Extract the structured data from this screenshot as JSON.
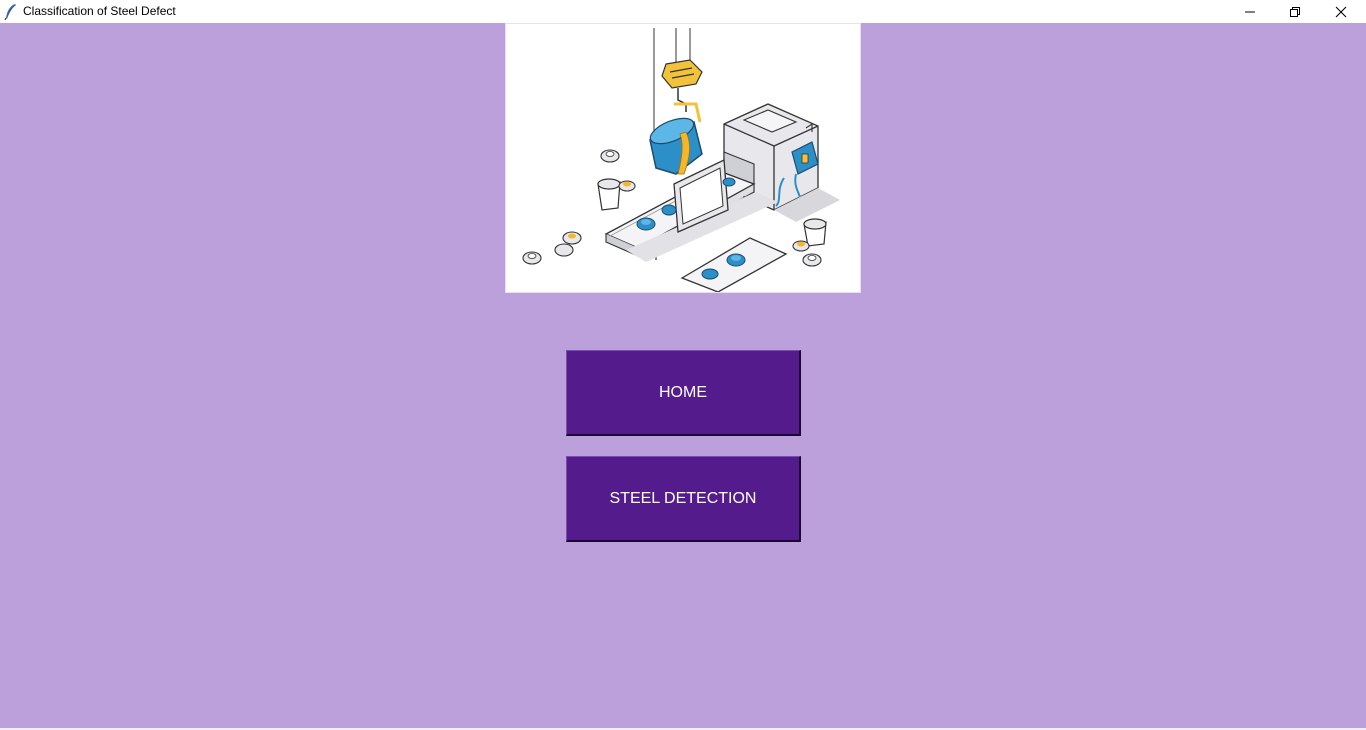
{
  "window": {
    "title": "Classification of Steel Defect",
    "icon": "tk-feather-icon",
    "controls": [
      "minimize-icon",
      "maximize-icon",
      "close-icon"
    ]
  },
  "colors": {
    "background": "#bba0db",
    "button": "#541b8c",
    "button_text": "#ffffff"
  },
  "banner": {
    "illustration": "steel-factory-illustration"
  },
  "buttons": {
    "home_label": "HOME",
    "steel_detection_label": "STEEL DETECTION"
  }
}
